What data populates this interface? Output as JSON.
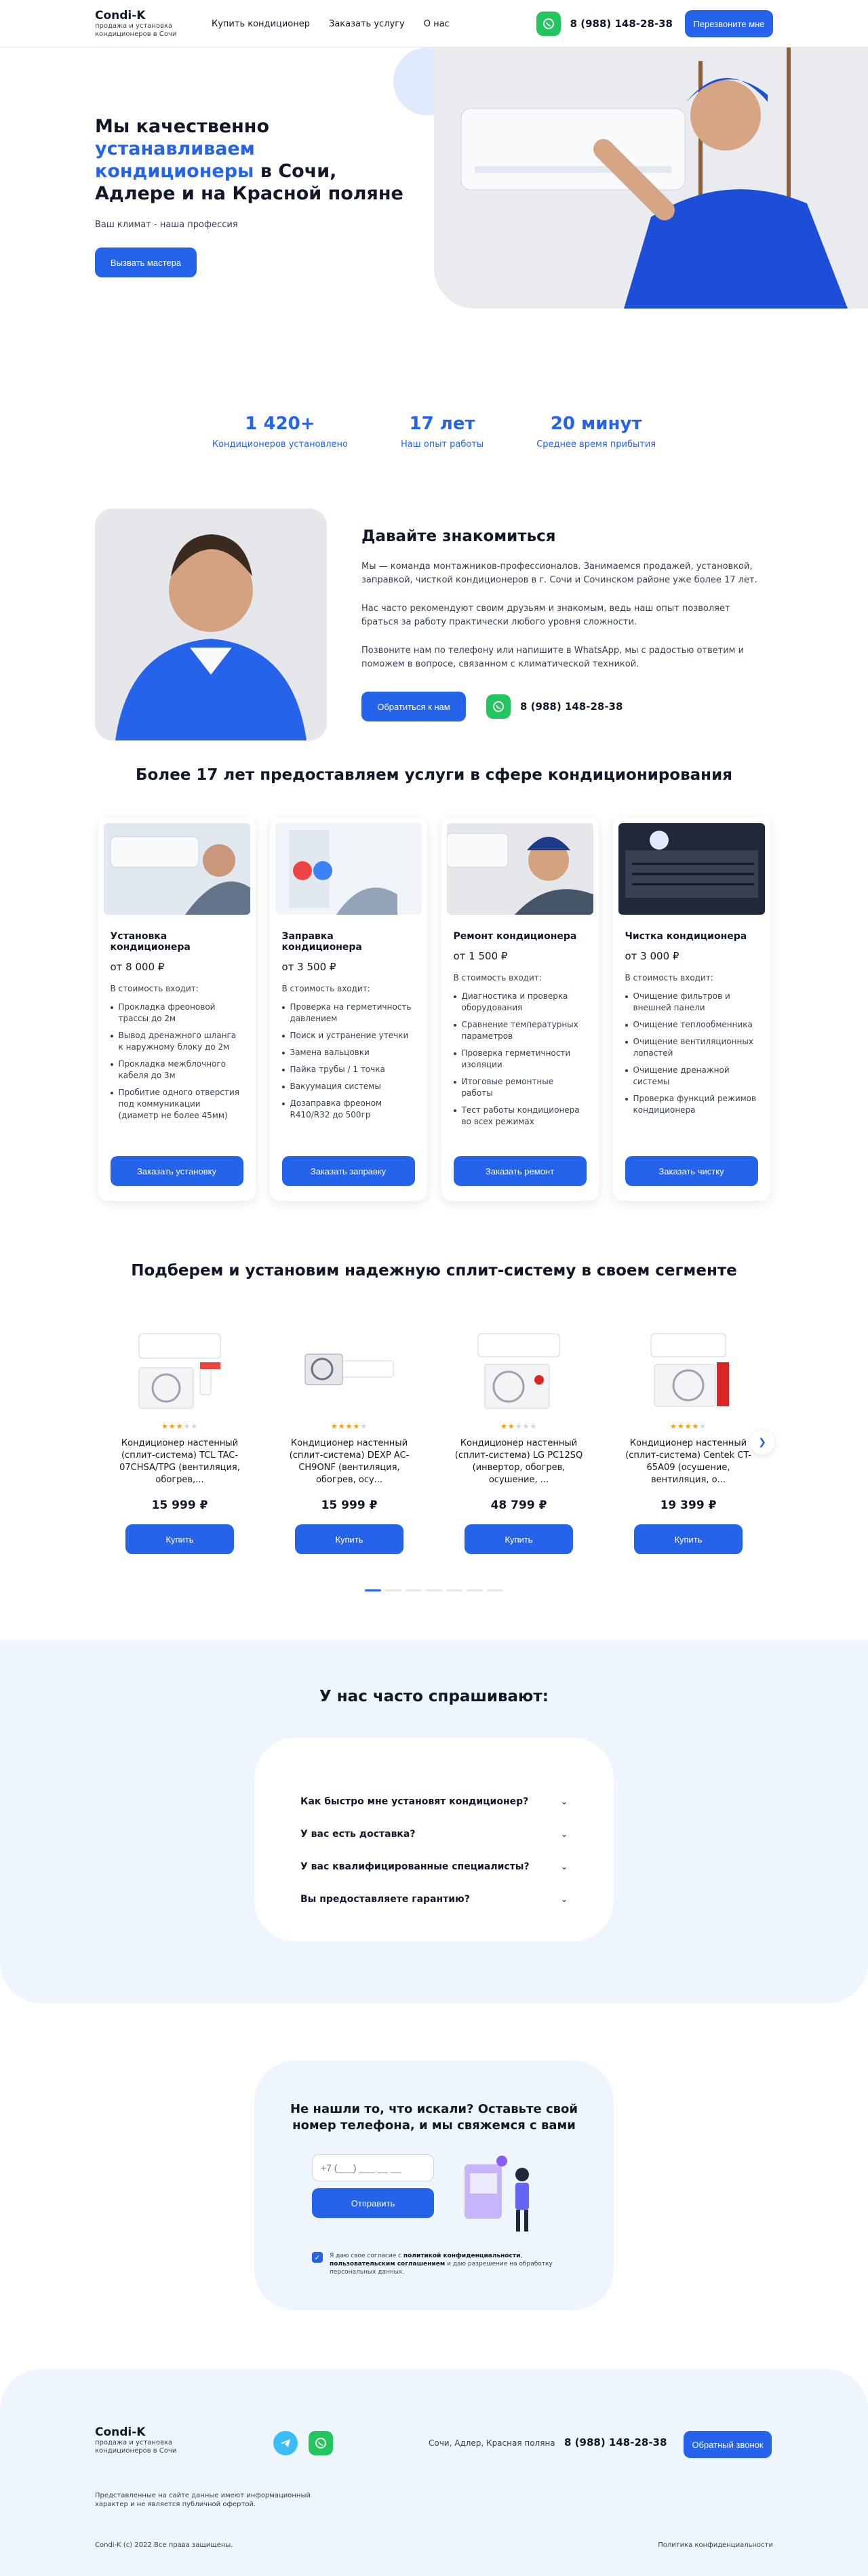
{
  "colors": {
    "accent": "#2563eb",
    "whatsapp": "#22c55e",
    "light_bg": "#eff5fd",
    "star": "#f59e0b"
  },
  "header": {
    "logo": "Condi-K",
    "tagline": "продажа и установка кондиционеров в Сочи",
    "nav": [
      "Купить кондиционер",
      "Заказать услугу",
      "О нас"
    ],
    "phone": "8 (988) 148-28-38",
    "callback_label": "Перезвоните мне",
    "whatsapp_icon": "whatsapp-icon"
  },
  "hero": {
    "title_part1": "Мы качественно ",
    "title_accent": "устанавливаем кондиционеры",
    "title_part2": " в Сочи, Адлере и на Красной поляне",
    "subtitle": "Ваш климат - наша профессия",
    "button": "Вызвать мастера"
  },
  "stats": [
    {
      "value": "1 420+",
      "label": "Кондиционеров установлено"
    },
    {
      "value": "17 лет",
      "label": "Наш опыт работы"
    },
    {
      "value": "20 минут",
      "label": "Среднее время прибытия"
    }
  ],
  "about": {
    "title": "Давайте знакомиться",
    "p1": "Мы — команда монтажников-профессионалов. Занимаемся продажей, установкой, заправкой, чисткой кондиционеров в г. Сочи и Сочинском районе уже более 17 лет.",
    "p2": "Нас часто рекомендуют своим друзьям и знакомым, ведь наш опыт позволяет браться за работу практически любого уровня сложности.",
    "p3": "Позвоните нам по телефону или напишите в WhatsApp, мы с радостью ответим и поможем в вопросе, связанном с климатической техникой.",
    "button": "Обратиться к нам",
    "phone": "8 (988) 148-28-38"
  },
  "services": {
    "title": "Более 17 лет предоставляем услуги в сфере кондиционирования",
    "included_label": "В стоимость входит:",
    "cards": [
      {
        "title": "Установка кондиционера",
        "price": "от 8 000 ₽",
        "items": [
          "Прокладка фреоновой трассы до 2м",
          "Вывод дренажного шланга к наружному блоку до 2м",
          "Прокладка межблочного кабеля до 3м",
          "Пробитие одного отверстия под коммуникации (диаметр не более 45мм)"
        ],
        "button": "Заказать установку"
      },
      {
        "title": "Заправка кондиционера",
        "price": "от 3 500 ₽",
        "items": [
          "Проверка на герметичность давлением",
          "Поиск и устранение утечки",
          "Замена вальцовки",
          "Пайка трубы / 1 точка",
          "Вакуумация системы",
          "Дозаправка фреоном R410/R32 до 500гр"
        ],
        "button": "Заказать заправку"
      },
      {
        "title": "Ремонт кондиционера",
        "price": "от 1 500 ₽",
        "items": [
          "Диагностика и проверка оборудования",
          "Сравнение температурных параметров",
          "Проверка герметичности изоляции",
          "Итоговые ремонтные работы",
          "Тест работы кондиционера во всех режимах"
        ],
        "button": "Заказать ремонт"
      },
      {
        "title": "Чистка кондиционера",
        "price": "от 3 000 ₽",
        "items": [
          "Очищение фильтров и внешней панели",
          "Очищение теплообменника",
          "Очищение вентиляционных лопастей",
          "Очищение дренажной системы",
          "Проверка функций режимов кондиционера"
        ],
        "button": "Заказать чистку"
      }
    ]
  },
  "products": {
    "title": "Подберем и установим надежную сплит-систему в своем сегменте",
    "buy_label": "Купить",
    "items": [
      {
        "name": "Кондиционер настенный (сплит-система) TCL TAC-07CHSA/TPG (вентиляция, обогрев,...",
        "price": "15 999 ₽",
        "rating": 3
      },
      {
        "name": "Кондиционер настенный (сплит-система) DEXP AC-CH9ONF (вентиляция, обогрев, осу...",
        "price": "15 999 ₽",
        "rating": 4
      },
      {
        "name": "Кондиционер настенный (сплит-система) LG PC12SQ (инвертор, обогрев, осушение, ...",
        "price": "48 799 ₽",
        "rating": 2
      },
      {
        "name": "Кондиционер настенный (сплит-система) Centek CT-65A09 (осушение, вентиляция, о...",
        "price": "19 399 ₽",
        "rating": 4
      }
    ],
    "pages": 7
  },
  "faq": {
    "title": "У нас часто спрашивают:",
    "items": [
      "Как быстро мне установят кондиционер?",
      "У вас есть доставка?",
      "У вас квалифицированные специалисты?",
      "Вы предоставляете гарантию?"
    ]
  },
  "contact": {
    "title": "Не нашли то, что искали? Оставьте свой номер телефона, и мы свяжемся с вами",
    "phone_placeholder": "+7 (___) ___ __ __",
    "button": "Отправить",
    "consent_pre": "Я даю свое согласие с ",
    "consent_b1": "политикой конфиденциальности",
    "consent_mid": ", ",
    "consent_b2": "пользовательским соглашением",
    "consent_post": " и даю разрешение на обработку персональных данных."
  },
  "footer": {
    "logo": "Condi-K",
    "tagline": "продажа и установка кондиционеров в Сочи",
    "address": "Сочи, Адлер, Красная поляна",
    "phone": "8 (988) 148-28-38",
    "callback": "Обратный звонок",
    "note": "Представленные на сайте данные имеют информационный характер и не является публичной офертой.",
    "copyright": "Condi-K (c) 2022 Все права защищены.",
    "policy": "Политика конфиденциальности"
  }
}
